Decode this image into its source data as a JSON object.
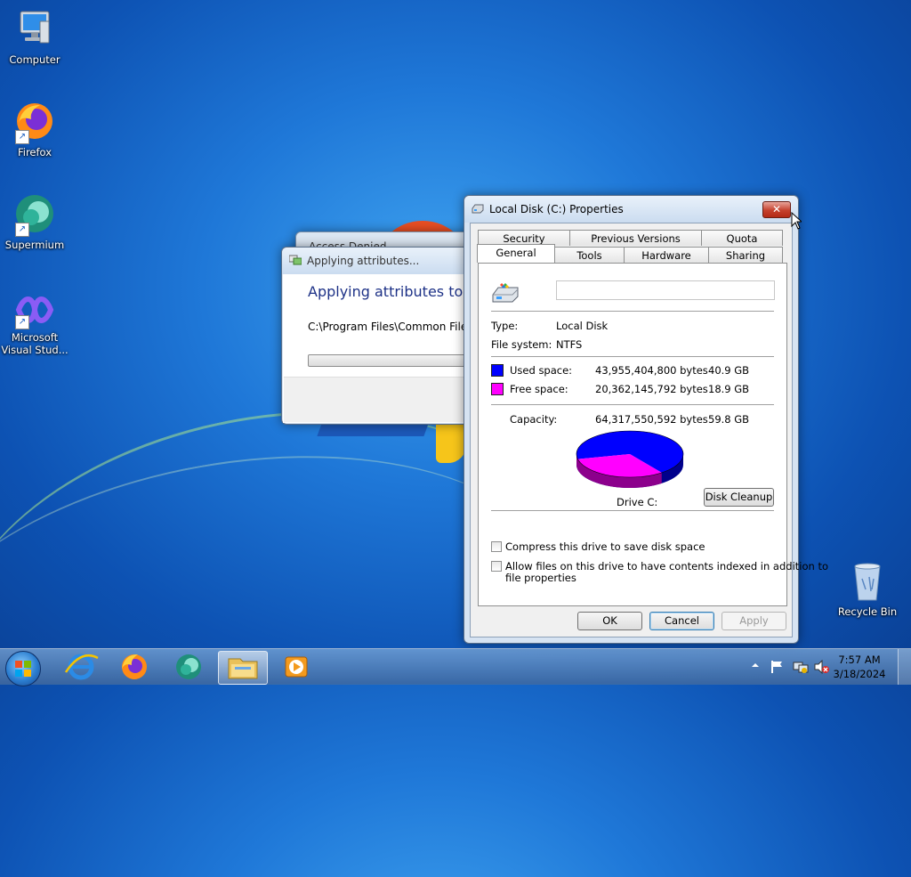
{
  "desktop": {
    "icons": [
      {
        "label": "Computer"
      },
      {
        "label": "Firefox"
      },
      {
        "label": "Supermium"
      },
      {
        "label": "Microsoft Visual Stud..."
      },
      {
        "label": "Recycle Bin"
      }
    ]
  },
  "access_dialog": {
    "title": "Access Denied"
  },
  "apply_dialog": {
    "title": "Applying attributes...",
    "heading": "Applying attributes to:",
    "path": "C:\\Program Files\\Common Files\\"
  },
  "props_dialog": {
    "title": "Local Disk (C:) Properties",
    "close_label": "✕",
    "tabs_row1": [
      "Security",
      "Previous Versions",
      "Quota"
    ],
    "tabs_row2": [
      "General",
      "Tools",
      "Hardware",
      "Sharing"
    ],
    "active_tab": "General",
    "name_value": "",
    "type_label": "Type:",
    "type_value": "Local Disk",
    "fs_label": "File system:",
    "fs_value": "NTFS",
    "used_label": "Used space:",
    "used_bytes": "43,955,404,800 bytes",
    "used_gb": "40.9 GB",
    "used_color": "#0000ff",
    "free_label": "Free space:",
    "free_bytes": "20,362,145,792 bytes",
    "free_gb": "18.9 GB",
    "free_color": "#ff00ff",
    "capacity_label": "Capacity:",
    "capacity_bytes": "64,317,550,592 bytes",
    "capacity_gb": "59.8 GB",
    "used_fraction": 0.6834,
    "drive_label": "Drive C:",
    "cleanup_button": "Disk Cleanup",
    "compress_label": "Compress this drive to save disk space",
    "compress_checked": false,
    "index_label_line1": "Allow files on this drive to have contents indexed in addition to",
    "index_label_line2": "file properties",
    "index_checked": false,
    "ok_button": "OK",
    "cancel_button": "Cancel",
    "apply_button": "Apply"
  },
  "taskbar": {
    "apps": [
      "internet-explorer-icon",
      "firefox-icon",
      "supermium-icon",
      "file-explorer-icon",
      "media-player-icon"
    ],
    "active_app": "file-explorer-icon",
    "clock_time": "7:57 AM",
    "clock_date": "3/18/2024"
  }
}
